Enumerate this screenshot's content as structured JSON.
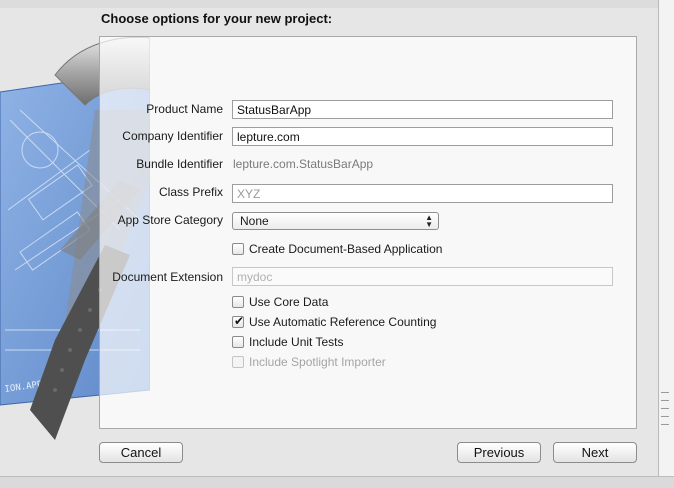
{
  "dialog": {
    "title": "Choose options for your new project:"
  },
  "form": {
    "product_name": {
      "label": "Product Name",
      "value": "StatusBarApp"
    },
    "company_identifier": {
      "label": "Company Identifier",
      "value": "lepture.com"
    },
    "bundle_identifier": {
      "label": "Bundle Identifier",
      "value": "lepture.com.StatusBarApp"
    },
    "class_prefix": {
      "label": "Class Prefix",
      "placeholder": "XYZ"
    },
    "app_store_category": {
      "label": "App Store Category",
      "selected": "None"
    },
    "document_extension": {
      "label": "Document Extension",
      "placeholder": "mydoc"
    }
  },
  "options": {
    "create_document_based": {
      "label": "Create Document-Based Application",
      "checked": false
    },
    "use_core_data": {
      "label": "Use Core Data",
      "checked": false
    },
    "use_arc": {
      "label": "Use Automatic Reference Counting",
      "checked": true
    },
    "include_unit_tests": {
      "label": "Include Unit Tests",
      "checked": false
    },
    "include_spotlight_importer": {
      "label": "Include Spotlight Importer",
      "checked": false,
      "disabled": true
    }
  },
  "buttons": {
    "cancel": "Cancel",
    "previous": "Previous",
    "next": "Next"
  },
  "art": {
    "blueprint_text": "ION.APP"
  },
  "colors": {
    "blueprint": "#6a93cf",
    "hammer_metal": "#9c9c9c",
    "hammer_grip": "#5a5a5a"
  }
}
